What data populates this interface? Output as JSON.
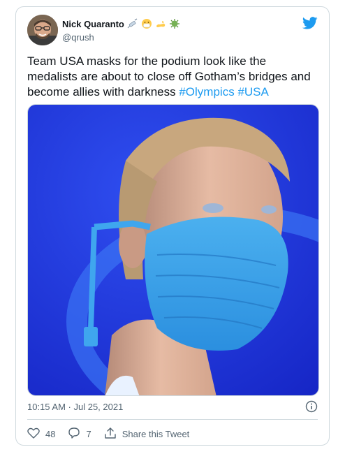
{
  "author": {
    "display_name": "Nick Quaranto",
    "handle": "@qrush"
  },
  "tweet": {
    "text": "Team USA masks for the podium look like the medalists are about to close off Gotham’s bridges and become allies with darkness",
    "hashtags": [
      "#Olympics",
      "#USA"
    ]
  },
  "meta": {
    "timestamp": "10:15 AM · Jul 25, 2021"
  },
  "actions": {
    "like_count": "48",
    "reply_count": "7",
    "share_label": "Share this Tweet"
  },
  "icons": {
    "brand": "twitter-bird-icon",
    "name_emojis": [
      "syringe-icon",
      "mask-face-icon",
      "flexed-arm-icon",
      "virus-icon"
    ],
    "info": "info-icon",
    "like": "heart-icon",
    "reply": "reply-icon",
    "share": "share-icon"
  },
  "colors": {
    "accent": "#1d9bf0",
    "text": "#0f1419",
    "secondary_text": "#536471",
    "border": "#cfd9de"
  }
}
